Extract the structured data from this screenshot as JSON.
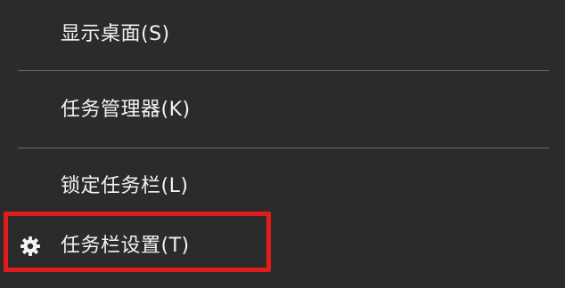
{
  "context_menu": {
    "items": [
      {
        "label": "显示桌面(S)"
      },
      {
        "label": "任务管理器(K)"
      },
      {
        "label": "锁定任务栏(L)"
      },
      {
        "label": "任务栏设置(T)",
        "icon": "gear-icon"
      }
    ],
    "highlight_color": "#e21b1b",
    "background_color": "#2b2b2b"
  }
}
